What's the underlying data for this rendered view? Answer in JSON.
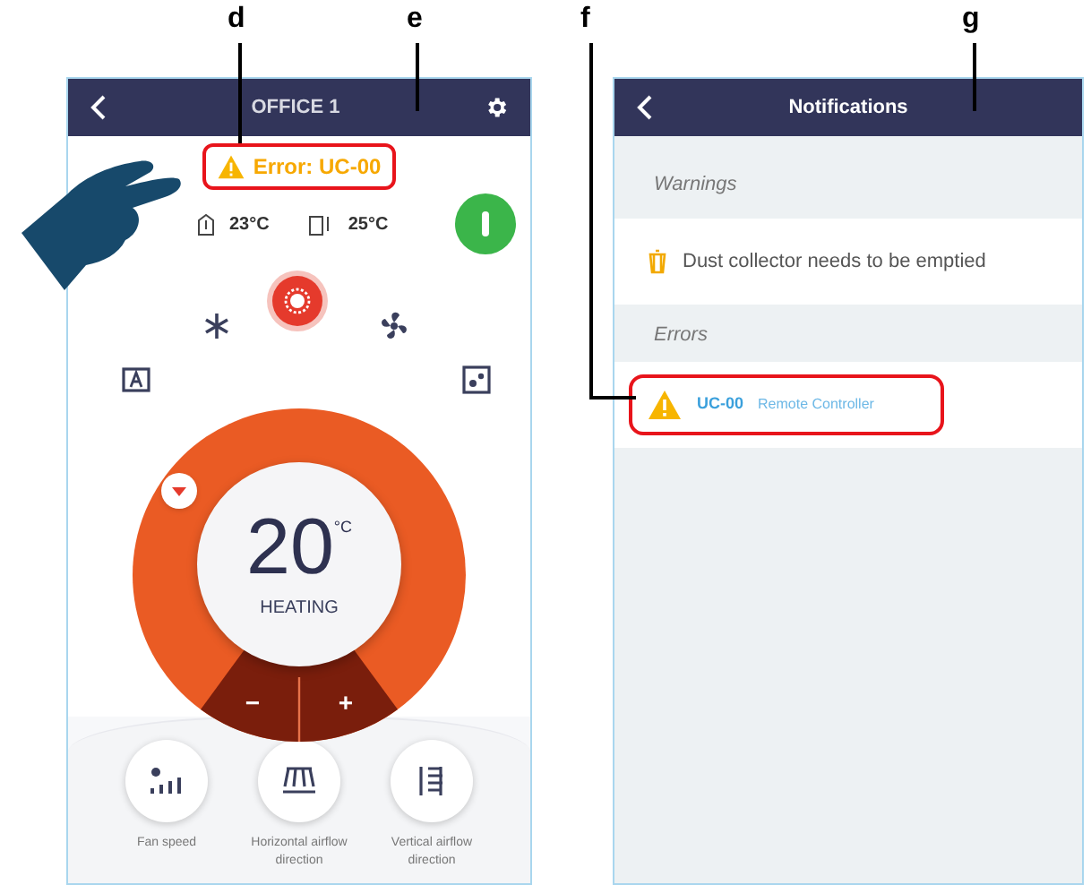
{
  "callouts": [
    {
      "label": "d"
    },
    {
      "label": "e"
    },
    {
      "label": "f"
    },
    {
      "label": "g"
    }
  ],
  "main_screen": {
    "title": "OFFICE 1",
    "error": {
      "text": "Error: UC-00",
      "highlighted": true
    },
    "indoor_temp": "23°C",
    "outdoor_temp": "25°C",
    "power_on": true,
    "modes": [
      {
        "kind": "auto",
        "selected": false
      },
      {
        "kind": "cool",
        "selected": false
      },
      {
        "kind": "heat",
        "selected": true
      },
      {
        "kind": "fan",
        "selected": false
      },
      {
        "kind": "dry",
        "selected": false
      }
    ],
    "setpoint": "20",
    "unit": "°C",
    "mode_label": "HEATING",
    "minus": "−",
    "plus": "+",
    "controls": [
      {
        "kind": "fan_speed",
        "label": "Fan speed"
      },
      {
        "kind": "horizontal",
        "label": "Horizontal airflow direction"
      },
      {
        "kind": "vertical",
        "label": "Vertical airflow direction"
      }
    ]
  },
  "notifications": {
    "title": "Notifications",
    "sections": [
      {
        "heading": "Warnings",
        "items": [
          {
            "kind": "dust",
            "text": "Dust collector needs to be emptied",
            "highlighted": false
          }
        ]
      },
      {
        "heading": "Errors",
        "items": [
          {
            "kind": "error",
            "code": "UC-00",
            "text": "Remote Controller",
            "highlighted": true
          }
        ]
      }
    ]
  }
}
